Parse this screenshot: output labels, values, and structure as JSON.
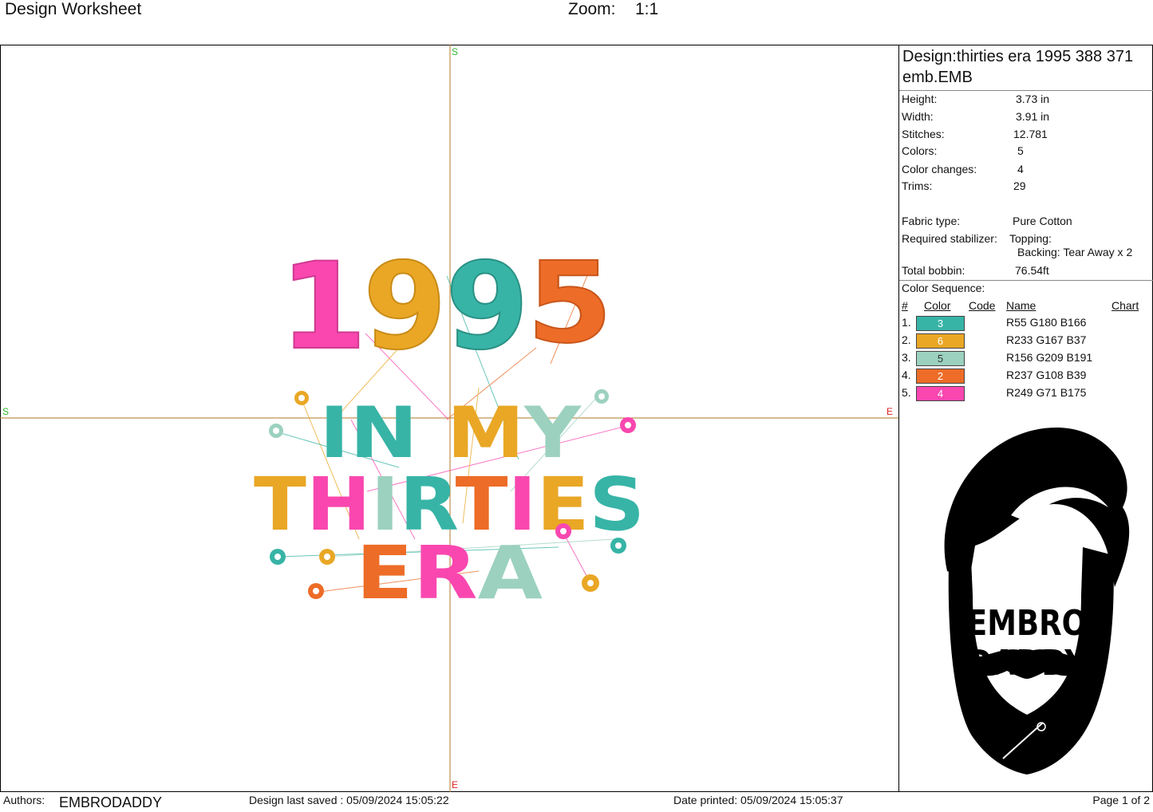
{
  "header": {
    "title": "Design Worksheet",
    "zoom_label": "Zoom:",
    "zoom_value": "1:1"
  },
  "canvas": {
    "axis_top": "S",
    "axis_left": "S",
    "axis_right": "E",
    "axis_bottom": "E",
    "design_text": {
      "line1": "1995",
      "line2": "IN MY",
      "line3": "THIRTIES",
      "line4": "ERA"
    },
    "colors": {
      "teal": "#37B4A6",
      "yellow": "#E9A725",
      "mint": "#9CD1BF",
      "orange": "#ED6C27",
      "pink": "#F947AF",
      "axis": "#B07A2A"
    }
  },
  "side": {
    "design_title": "Design:thirties era 1995 388 371 emb.EMB",
    "specs": [
      {
        "label": "Height:",
        "value": "3.73 in"
      },
      {
        "label": "Width:",
        "value": "3.91 in"
      },
      {
        "label": "Stitches:",
        "value": "12.781"
      },
      {
        "label": "Colors:",
        "value": "5"
      },
      {
        "label": "Color changes:",
        "value": "4"
      },
      {
        "label": "Trims:",
        "value": "29"
      }
    ],
    "fabric_label": "Fabric type:",
    "fabric_value": "Pure Cotton",
    "stabilizer_label": "Required stabilizer:",
    "topping": "Topping:",
    "backing": "Backing: Tear Away x 2",
    "bobbin_label": "Total bobbin:",
    "bobbin_value": "76.54ft",
    "color_sequence_label": "Color Sequence:",
    "seq_headers": {
      "num": "#",
      "color": "Color",
      "code": "Code",
      "name": "Name",
      "chart": "Chart"
    },
    "sequence": [
      {
        "num": "1.",
        "code": "3",
        "rgb": "R55 G180 B166",
        "hex": "#37B4A6"
      },
      {
        "num": "2.",
        "code": "6",
        "rgb": "R233 G167 B37",
        "hex": "#E9A725"
      },
      {
        "num": "3.",
        "code": "5",
        "rgb": "R156 G209 B191",
        "hex": "#9CD1BF"
      },
      {
        "num": "4.",
        "code": "2",
        "rgb": "R237 G108 B39",
        "hex": "#ED6C27"
      },
      {
        "num": "5.",
        "code": "4",
        "rgb": "R249 G71 B175",
        "hex": "#F947AF"
      }
    ],
    "logo_line1": "EMBRO",
    "logo_line2": "DADDY"
  },
  "footer": {
    "authors_label": "Authors:",
    "authors_value": "EMBRODADDY",
    "saved": "Design last saved : 05/09/2024 15:05:22",
    "printed": "Date printed: 05/09/2024 15:05:37",
    "page": "Page 1 of 2"
  }
}
